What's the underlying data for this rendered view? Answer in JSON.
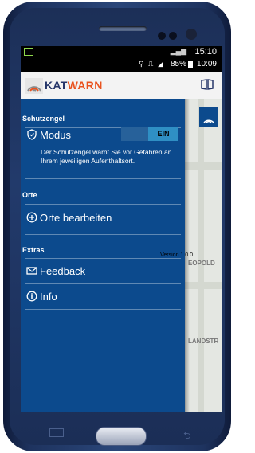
{
  "status_bar": {
    "time_top": "15:10",
    "battery": "85%",
    "time": "10:09"
  },
  "app_bar": {
    "logo_part1": "KAT",
    "logo_part2": "WARN",
    "colors": {
      "logo_dark": "#26366a",
      "logo_orange": "#e9531f"
    }
  },
  "drawer": {
    "background": "#0c4a8d",
    "sections": {
      "schutzengel": "Schutzengel",
      "orte": "Orte",
      "extras": "Extras"
    },
    "modus": {
      "label": "Modus",
      "toggle_state": "EIN",
      "description": "Der Schutzengel warnt Sie vor Gefahren an Ihrem jeweiligen Aufenthaltsort."
    },
    "orte_bearbeiten": "Orte bearbeiten",
    "version": "Version 1.0.0",
    "feedback": "Feedback",
    "info": "Info"
  },
  "map": {
    "labels": [
      "EOPOLD",
      "LANDSTR"
    ],
    "icons": [
      "map-layer-icon"
    ]
  }
}
